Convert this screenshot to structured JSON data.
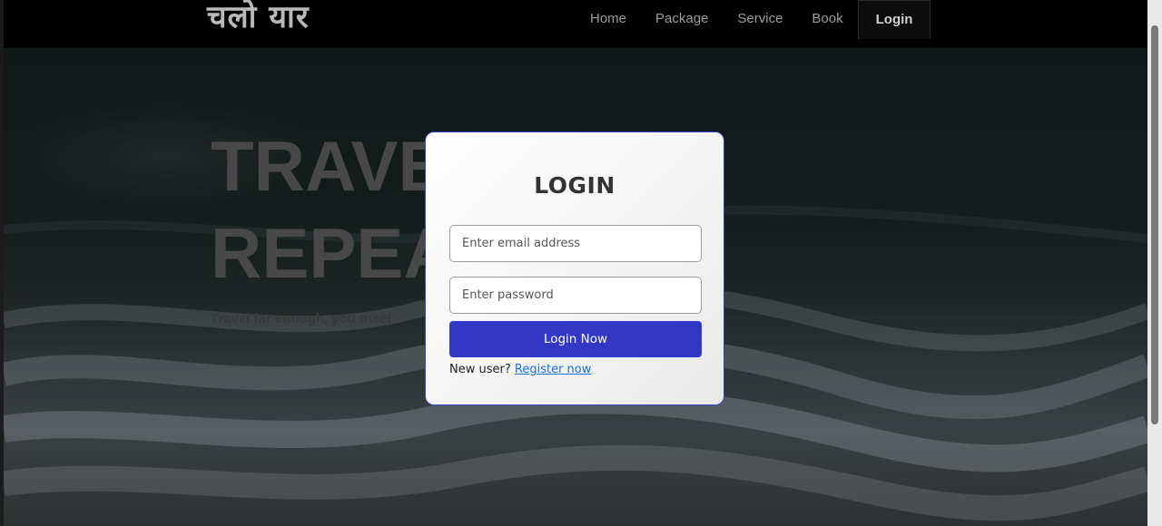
{
  "navbar": {
    "logo": "चलो यार",
    "links": [
      "Home",
      "Package",
      "Service",
      "Book",
      "Login"
    ]
  },
  "hero": {
    "title_line1": "TRAVEL",
    "title_line2": "REPEAT",
    "subtitle": "Travel far enough, you meet"
  },
  "login_modal": {
    "title": "LOGIN",
    "email_placeholder": "Enter email address",
    "password_placeholder": "Enter password",
    "submit_label": "Login Now",
    "register_prompt": "New user?",
    "register_link": "Register now"
  },
  "colors": {
    "accent": "#3337c5",
    "link": "#1a6fd6",
    "modal_border": "#3b43c8"
  }
}
